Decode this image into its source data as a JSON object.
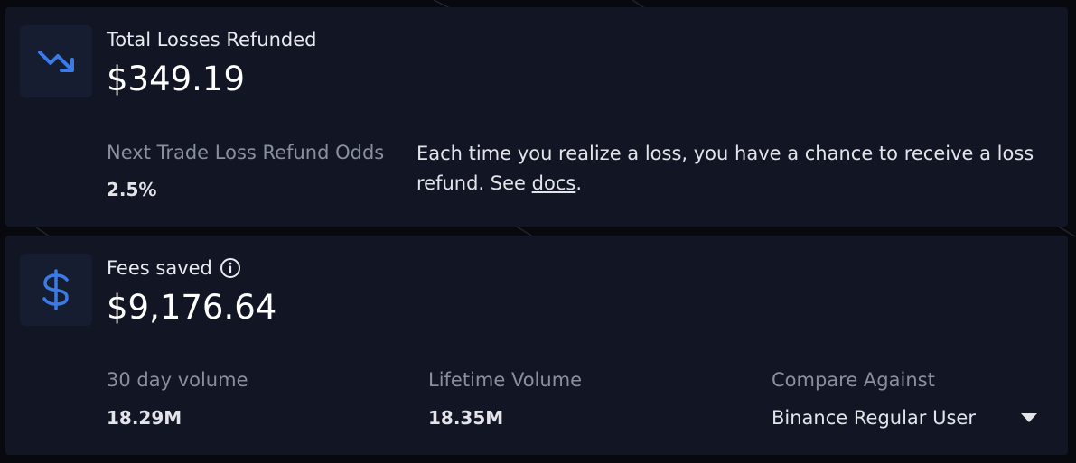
{
  "losses": {
    "title": "Total Losses Refunded",
    "value": "$349.19",
    "icon": "trending-down-icon",
    "odds_label": "Next Trade Loss Refund Odds",
    "odds_value": "2.5%",
    "description_text": "Each time you realize a loss, you have a chance to receive a loss refund. See ",
    "docs_link": "docs",
    "description_end": "."
  },
  "fees": {
    "title": "Fees saved",
    "value": "$9,176.64",
    "icon": "dollar-icon",
    "volume_30d_label": "30 day volume",
    "volume_30d_value": "18.29M",
    "lifetime_label": "Lifetime Volume",
    "lifetime_value": "18.35M",
    "compare_label": "Compare Against",
    "compare_selected": "Binance Regular User"
  },
  "colors": {
    "accent": "#3b7be6",
    "card_bg": "#121624",
    "page_bg": "#07090e"
  }
}
